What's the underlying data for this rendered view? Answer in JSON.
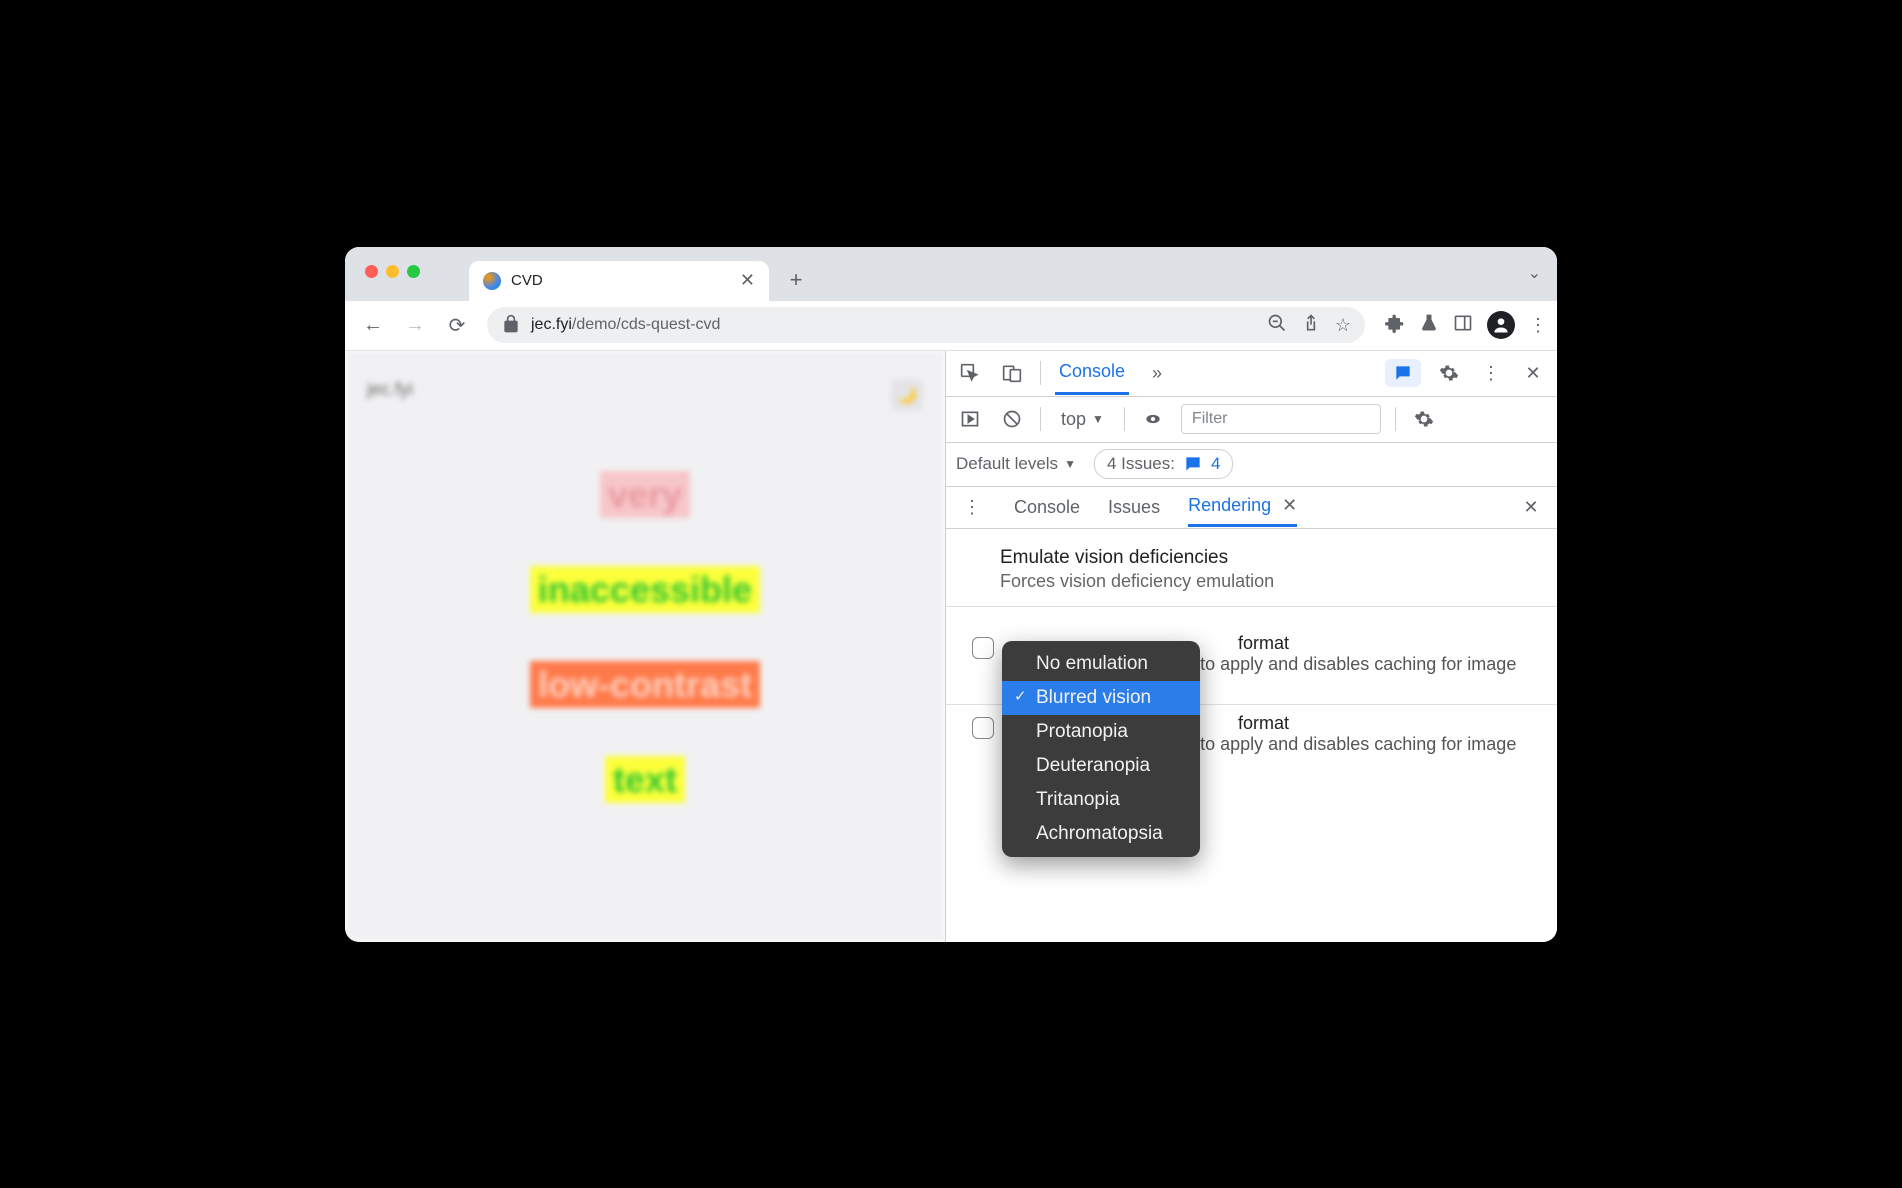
{
  "tab": {
    "title": "CVD"
  },
  "url": {
    "host": "jec.fyi",
    "path": "/demo/cds-quest-cvd"
  },
  "page": {
    "logo": "jec.fyi",
    "words": [
      "very",
      "inaccessible",
      "low-contrast",
      "text"
    ]
  },
  "devtools": {
    "tab_console": "Console",
    "context": "top",
    "filter_placeholder": "Filter",
    "default_levels": "Default levels",
    "issues_label": "4 Issues:",
    "issues_count": "4",
    "drawer": {
      "console": "Console",
      "issues": "Issues",
      "rendering": "Rendering"
    },
    "emulate": {
      "title": "Emulate vision deficiencies",
      "desc": "Forces vision deficiency emulation"
    },
    "avif": {
      "title_suffix": "format",
      "desc": "Requires a page reload to apply and disables caching for image requests."
    },
    "webp": {
      "title_suffix": "format",
      "desc": "Requires a page reload to apply and disables caching for image requests."
    }
  },
  "dropdown": {
    "items": [
      "No emulation",
      "Blurred vision",
      "Protanopia",
      "Deuteranopia",
      "Tritanopia",
      "Achromatopsia"
    ],
    "selected_index": 1
  }
}
